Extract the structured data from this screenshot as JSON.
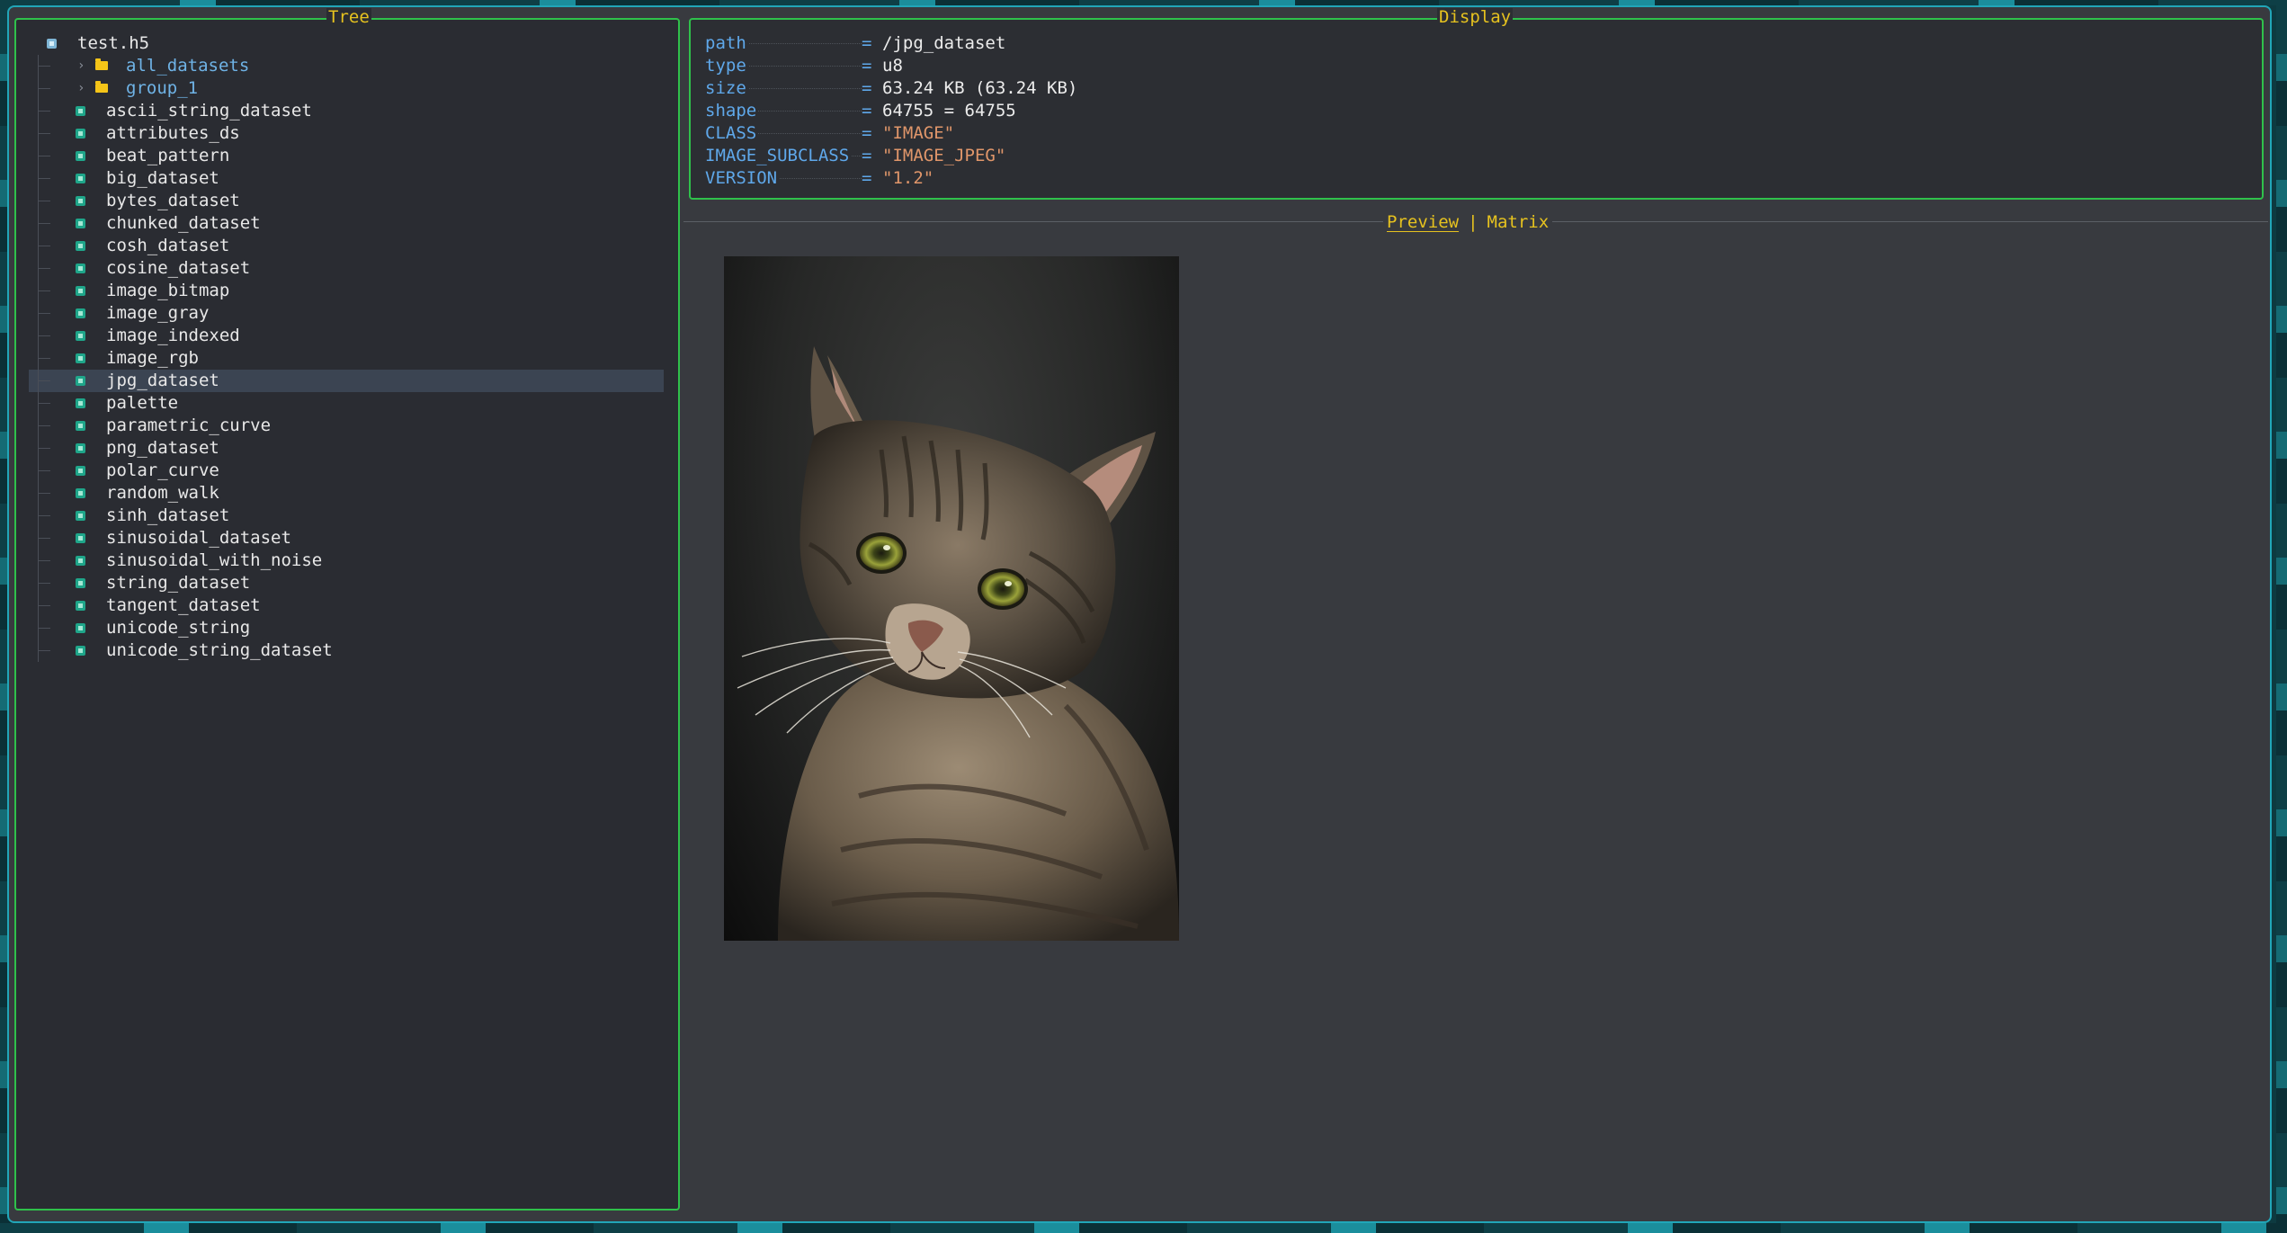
{
  "tree": {
    "title": "Tree",
    "root": "test.h5",
    "groups": [
      {
        "label": "all_datasets"
      },
      {
        "label": "group_1"
      }
    ],
    "datasets": [
      {
        "label": "ascii_string_dataset"
      },
      {
        "label": "attributes_ds"
      },
      {
        "label": "beat_pattern"
      },
      {
        "label": "big_dataset"
      },
      {
        "label": "bytes_dataset"
      },
      {
        "label": "chunked_dataset"
      },
      {
        "label": "cosh_dataset"
      },
      {
        "label": "cosine_dataset"
      },
      {
        "label": "image_bitmap"
      },
      {
        "label": "image_gray"
      },
      {
        "label": "image_indexed"
      },
      {
        "label": "image_rgb"
      },
      {
        "label": "jpg_dataset",
        "selected": true
      },
      {
        "label": "palette"
      },
      {
        "label": "parametric_curve"
      },
      {
        "label": "png_dataset"
      },
      {
        "label": "polar_curve"
      },
      {
        "label": "random_walk"
      },
      {
        "label": "sinh_dataset"
      },
      {
        "label": "sinusoidal_dataset"
      },
      {
        "label": "sinusoidal_with_noise"
      },
      {
        "label": "string_dataset"
      },
      {
        "label": "tangent_dataset"
      },
      {
        "label": "unicode_string"
      },
      {
        "label": "unicode_string_dataset"
      }
    ]
  },
  "display": {
    "title": "Display",
    "attributes": [
      {
        "key": "path",
        "eq": "=",
        "value": "/jpg_dataset",
        "kind": "plain"
      },
      {
        "key": "type",
        "eq": "=",
        "value": "u8",
        "kind": "plain"
      },
      {
        "key": "size",
        "eq": "=",
        "value": "63.24 KB (63.24 KB)",
        "kind": "plain"
      },
      {
        "key": "shape",
        "eq": "=",
        "value": "64755 = 64755",
        "kind": "plain"
      },
      {
        "key": "CLASS",
        "eq": "=",
        "value": "\"IMAGE\"",
        "kind": "string"
      },
      {
        "key": "IMAGE_SUBCLASS",
        "eq": "=",
        "value": "\"IMAGE_JPEG\"",
        "kind": "string"
      },
      {
        "key": "VERSION",
        "eq": "=",
        "value": "\"1.2\"",
        "kind": "string"
      }
    ]
  },
  "tabs": {
    "preview": "Preview",
    "separator": "|",
    "matrix": "Matrix",
    "active": "Preview"
  },
  "preview": {
    "content": "tabby-kitten-photo"
  },
  "colors": {
    "border_green": "#2fc14b",
    "title_yellow": "#e6c21f",
    "key_blue": "#5fa8ea",
    "string_orange": "#e0966a",
    "dataset_teal": "#1fa68a",
    "folder_yellow": "#f5c518"
  }
}
